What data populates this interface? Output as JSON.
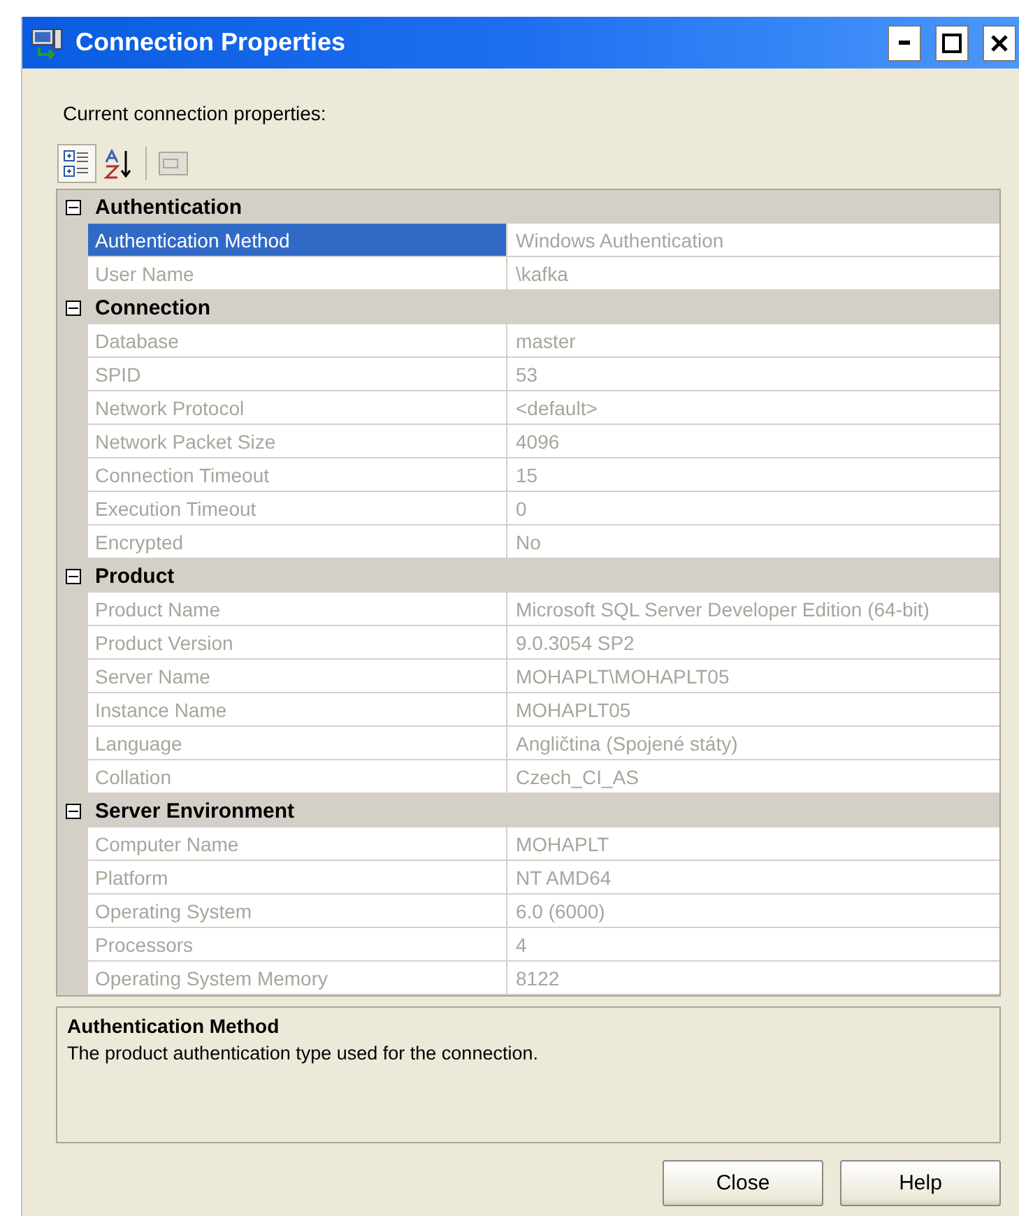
{
  "window": {
    "title": "Connection Properties"
  },
  "heading": "Current connection properties:",
  "toolbar": [
    {
      "kind": "categorized",
      "selected": true,
      "disabled": false
    },
    {
      "kind": "alphabetical",
      "selected": false,
      "disabled": false
    },
    {
      "kind": "property_pages",
      "selected": false,
      "disabled": true
    }
  ],
  "groups": [
    {
      "name": "Authentication",
      "expanded": true,
      "rows": [
        {
          "name": "Authentication Method",
          "value": "Windows Authentication",
          "selected": true
        },
        {
          "name": "User Name",
          "value": "\\kafka",
          "selected": false
        }
      ]
    },
    {
      "name": "Connection",
      "expanded": true,
      "rows": [
        {
          "name": "Database",
          "value": "master",
          "selected": false
        },
        {
          "name": "SPID",
          "value": "53",
          "selected": false
        },
        {
          "name": "Network Protocol",
          "value": "<default>",
          "selected": false
        },
        {
          "name": "Network Packet Size",
          "value": "4096",
          "selected": false
        },
        {
          "name": "Connection Timeout",
          "value": "15",
          "selected": false
        },
        {
          "name": "Execution Timeout",
          "value": "0",
          "selected": false
        },
        {
          "name": "Encrypted",
          "value": "No",
          "selected": false
        }
      ]
    },
    {
      "name": "Product",
      "expanded": true,
      "rows": [
        {
          "name": "Product Name",
          "value": "Microsoft SQL Server Developer Edition (64-bit)",
          "selected": false
        },
        {
          "name": "Product Version",
          "value": "9.0.3054 SP2",
          "selected": false
        },
        {
          "name": "Server Name",
          "value": "MOHAPLT\\MOHAPLT05",
          "selected": false
        },
        {
          "name": "Instance Name",
          "value": "MOHAPLT05",
          "selected": false
        },
        {
          "name": "Language",
          "value": "Angličtina (Spojené státy)",
          "selected": false
        },
        {
          "name": "Collation",
          "value": "Czech_CI_AS",
          "selected": false
        }
      ]
    },
    {
      "name": "Server Environment",
      "expanded": true,
      "rows": [
        {
          "name": "Computer Name",
          "value": "MOHAPLT",
          "selected": false
        },
        {
          "name": "Platform",
          "value": "NT AMD64",
          "selected": false
        },
        {
          "name": "Operating System",
          "value": "6.0 (6000)",
          "selected": false
        },
        {
          "name": "Processors",
          "value": "4",
          "selected": false
        },
        {
          "name": "Operating System Memory",
          "value": "8122",
          "selected": false
        }
      ]
    }
  ],
  "description": {
    "title": "Authentication Method",
    "text": "The product authentication type used for the connection."
  },
  "buttons": [
    "Close",
    "Help"
  ]
}
